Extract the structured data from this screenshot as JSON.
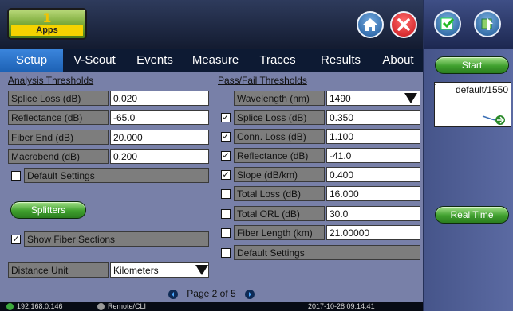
{
  "apps": {
    "count": "1",
    "label": "Apps"
  },
  "tabs": [
    {
      "label": "Setup",
      "active": true
    },
    {
      "label": "V-Scout"
    },
    {
      "label": "Events"
    },
    {
      "label": "Measure"
    },
    {
      "label": "Traces"
    },
    {
      "label": "Results"
    },
    {
      "label": "About"
    }
  ],
  "analysis": {
    "title": "Analysis Thresholds",
    "rows": [
      {
        "label": "Splice Loss (dB)",
        "value": "0.020"
      },
      {
        "label": "Reflectance (dB)",
        "value": "-65.0"
      },
      {
        "label": "Fiber End (dB)",
        "value": "20.000"
      },
      {
        "label": "Macrobend (dB)",
        "value": "0.200"
      }
    ],
    "default_settings": "Default Settings"
  },
  "splitters_button": "Splitters",
  "show_fiber_sections": "Show Fiber Sections",
  "distance_unit": {
    "label": "Distance Unit",
    "value": "Kilometers"
  },
  "passfail": {
    "title": "Pass/Fail Thresholds",
    "wavelength": {
      "label": "Wavelength (nm)",
      "value": "1490"
    },
    "rows": [
      {
        "label": "Splice Loss (dB)",
        "value": "0.350",
        "checked": true
      },
      {
        "label": "Conn. Loss (dB)",
        "value": "1.100",
        "checked": true
      },
      {
        "label": "Reflectance (dB)",
        "value": "-41.0",
        "checked": true
      },
      {
        "label": "Slope (dB/km)",
        "value": "0.400",
        "checked": true
      },
      {
        "label": "Total Loss (dB)",
        "value": "16.000",
        "checked": false
      },
      {
        "label": "Total ORL (dB)",
        "value": "30.0",
        "checked": false
      },
      {
        "label": "Fiber Length (km)",
        "value": "21.00000",
        "checked": false
      }
    ],
    "default_settings": "Default Settings"
  },
  "pager": {
    "text": "Page 2 of 5"
  },
  "right": {
    "start": "Start",
    "trace_label": "default/1550",
    "realtime": "Real Time"
  },
  "status": {
    "ip": "192.168.0.146",
    "remote": "Remote/CLI",
    "datetime": "2017-10-28 09:14:41"
  },
  "colors": {
    "accent": "#1d62b5",
    "panel": "#7880a8",
    "start_green": "#3fa02e"
  }
}
